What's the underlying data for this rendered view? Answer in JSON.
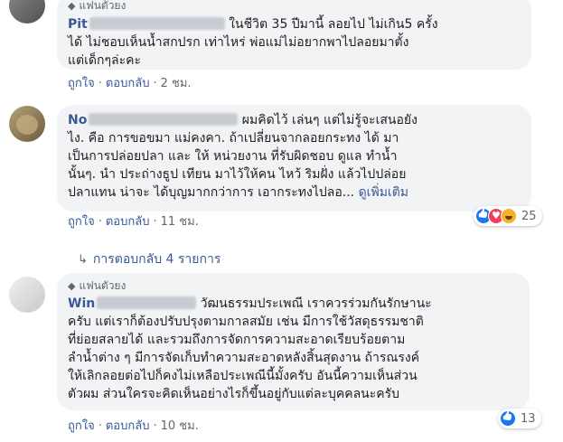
{
  "comments": [
    {
      "badge": "แฟนตัวยง",
      "author_visible": "Pit",
      "lines": [
        "ในชีวิต 35 ปีมานี้ ลอยไป ไม่เกิน5 ครั้ง",
        "ได้ ไม่ชอบเห็นน้ำสกปรก เท่าไหร่ พ่อแม่ไม่อยากพาไปลอยมาตั้ง",
        "แต่เด็กๆล่ะคะ"
      ],
      "like": "ถูกใจ",
      "reply": "ตอบกลับ",
      "time": "2 ชม."
    },
    {
      "author_visible": "No",
      "lines": [
        "ผมคิดไว้ เล่นๆ แต่ไม่รู้จะเสนอยัง",
        "ไง. คือ การขอขมา แม่คงคา. ถ้าเปลี่ยนจากลอยกระทง ได้ มา",
        "เป็นการปล่อยปลา และ ให้ หน่วยงาน ที่รับผิดชอบ ดูแล ทำน้ำ",
        "นั้นๆ. นำ ประถ่างธูป เทียน มาไว้ให้คน ไหว้ ริมฝั่ง แล้วไปปล่อย",
        "ปลาแทน น่าจะ ได้บุญมากกว่าการ เอากระทงไปลอ..."
      ],
      "see_more": "ดูเพิ่มเติม",
      "like": "ถูกใจ",
      "reply": "ตอบกลับ",
      "time": "11 ชม.",
      "reaction_count": "25",
      "replies_label": "การตอบกลับ 4 รายการ"
    },
    {
      "badge": "แฟนตัวยง",
      "author_visible": "Win",
      "lines": [
        "วัฒนธรรมประเพณี เราควรร่วมกันรักษานะ",
        "ครับ แต่เราก็ต้องปรับปรุงตามกาลสมัย เช่น มีการใช้วัสดุธรรมชาติ",
        "ที่ย่อยสลายได้ และรวมถึงการจัดการความสะอาดเรียบร้อยตาม",
        "ลำน้ำต่าง ๆ มีการจัดเก็บทำความสะอาดหลังสิ้นสุดงาน ถ้ารณรงค์",
        "ให้เลิกลอยต่อไปก็คงไม่เหลือประเพณีนี้มั้งครับ อันนี้ความเห็นส่วน",
        "ตัวผม ส่วนใครจะคิดเห็นอย่างไรก็ขึ้นอยู่กับแต่ละบุคคลนะครับ"
      ],
      "like": "ถูกใจ",
      "reply": "ตอบกลับ",
      "time": "10 ชม.",
      "reaction_count": "13"
    }
  ],
  "colors": {
    "link": "#385898",
    "bubble": "#f2f3f5",
    "meta": "#606770",
    "like_blue": "#1877f2",
    "love_red": "#f33e58",
    "haha_yellow": "#f7b125"
  },
  "icons": [
    "avatar",
    "diamond-badge-icon",
    "reply-arrow-icon",
    "like-reaction-icon",
    "love-reaction-icon",
    "haha-reaction-icon"
  ]
}
